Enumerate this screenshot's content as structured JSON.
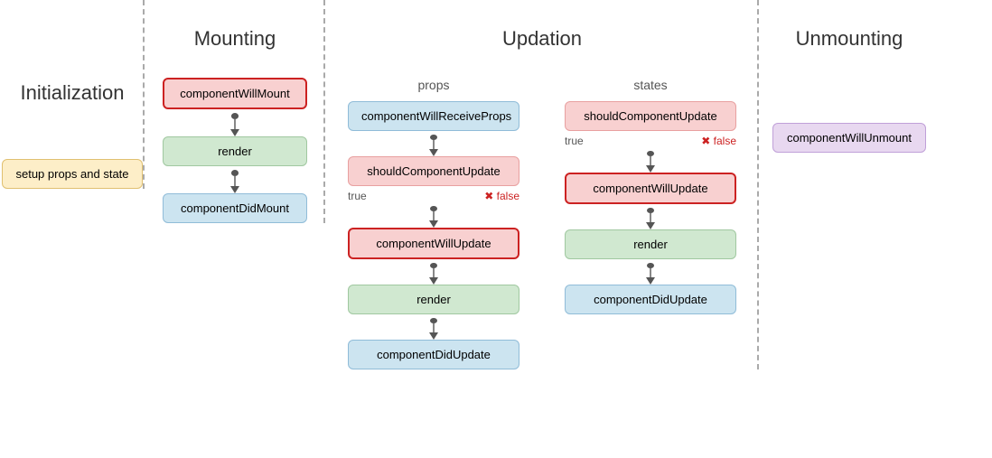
{
  "sections": {
    "initialization": {
      "title": "Initialization",
      "node": "setup props and state"
    },
    "mounting": {
      "title": "Mounting",
      "nodes": [
        "componentWillMount",
        "render",
        "componentDidMount"
      ]
    },
    "updation": {
      "title": "Updation",
      "props_label": "props",
      "states_label": "states",
      "props_nodes": [
        "componentWillReceiveProps",
        "shouldComponentUpdate",
        "componentWillUpdate",
        "render",
        "componentDidUpdate"
      ],
      "states_nodes": [
        "shouldComponentUpdate",
        "componentWillUpdate",
        "render",
        "componentDidUpdate"
      ]
    },
    "unmounting": {
      "title": "Unmounting",
      "node": "componentWillUnmount"
    }
  },
  "labels": {
    "true": "true",
    "false": "false"
  }
}
